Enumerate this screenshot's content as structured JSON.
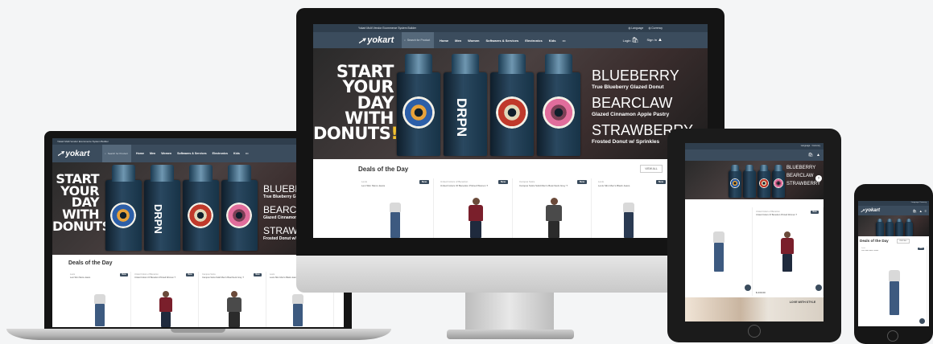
{
  "site": {
    "tagline": "Yokart Multi Vendor Ecommerce System Builder",
    "logo": "yokart",
    "search_placeholder": "Search for Product",
    "menu": [
      "Home",
      "Men",
      "Women",
      "Softwares & Services",
      "Electronics",
      "Kids",
      "•••"
    ],
    "top_right": [
      "Language",
      "Currency"
    ],
    "login": "Login",
    "signin": "Sign In"
  },
  "hero": {
    "left_lines": [
      "START",
      "YOUR",
      "DAY",
      "WITH",
      "DONUTS"
    ],
    "exclaim": "!",
    "bottle_label": "DRPN",
    "flavors": [
      {
        "name": "BLUEBERRY",
        "desc": "True Blueberry Glazed Donut"
      },
      {
        "name": "BEARCLAW",
        "desc": "Glazed Cinnamon Apple Pastry"
      },
      {
        "name": "STRAWBERRY",
        "desc": "Frosted Donut w/ Sprinkles"
      }
    ]
  },
  "deals": {
    "title": "Deals of the Day",
    "view_all": "VIEW ALL",
    "products": [
      {
        "brand": "Levis",
        "name": "Levi Slim Mens Jeans",
        "badge": "New"
      },
      {
        "brand": "United Colors of Benetton",
        "name": "United Colors Of Benetton Printed Women T",
        "badge": "New"
      },
      {
        "brand": "Campus Sutra",
        "name": "Campus Sutra Solid Men's Boat Neck Grey T",
        "badge": "New"
      },
      {
        "brand": "Levis",
        "name": "Levis Slim Men's Black Jeans",
        "badge": "New"
      }
    ]
  },
  "tablet": {
    "price": "$ 230.00",
    "promo": "LOVE WITH STYLE"
  },
  "colors": {
    "nav": "#3b4c5d",
    "strip": "#2f3e4d",
    "accent": "#e8a23a"
  }
}
